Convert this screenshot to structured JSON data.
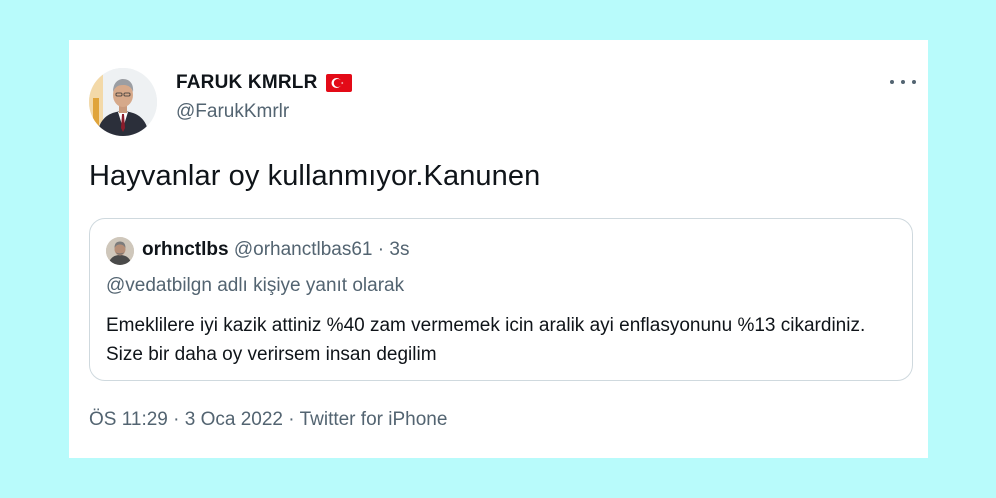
{
  "tweet": {
    "display_name": "FARUK KMRLR",
    "flag_icon": "turkey-flag-icon",
    "handle": "@FarukKmrlr",
    "text": "Hayvanlar oy kullanmıyor.Kanunen",
    "more_icon": "more-options-icon"
  },
  "quoted": {
    "name": "orhnctlbs",
    "handle": "@orhanctlbas61",
    "separator": "·",
    "time": "3s",
    "reply_context": "@vedatbilgn adlı kişiye yanıt olarak",
    "text": "Emeklilere iyi kazik attiniz %40 zam vermemek icin aralik ayi enflasyonunu %13 cikardiniz. Size bir daha oy verirsem insan degilim"
  },
  "meta": {
    "time": "ÖS 11:29",
    "separator1": "·",
    "date": "3 Oca 2022",
    "separator2": "·",
    "source": "Twitter for iPhone"
  },
  "colors": {
    "background": "#b8fbfb",
    "card": "#ffffff",
    "text_primary": "#0f1419",
    "text_secondary": "#536471",
    "border": "#cfd9de",
    "flag_red": "#e30a17"
  }
}
